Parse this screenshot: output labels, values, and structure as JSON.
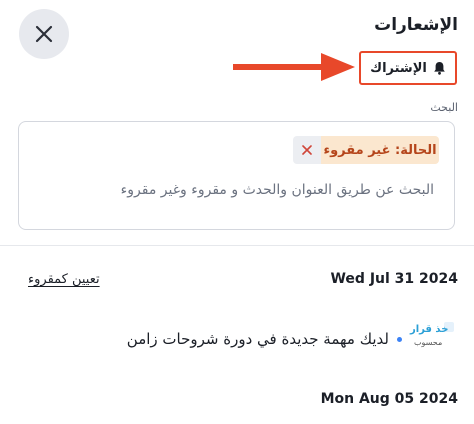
{
  "header": {
    "title": "الإشعارات",
    "subscribe_label": "الإشتراك"
  },
  "search": {
    "label": "البحث",
    "filter_chip": "الحالة: غير مقروء",
    "placeholder": "البحث عن طريق العنوان والحدث و مقروء وغير مقروء"
  },
  "groups": [
    {
      "date": "Wed Jul 31 2024",
      "action_label": "تعيين كمقروء",
      "notifications": [
        {
          "text": "لديك مهمة جديدة في دورة شروحات زامن",
          "logo_text_1": "خذ قرار",
          "logo_text_2": "محسوب"
        }
      ]
    },
    {
      "date": "Mon Aug 05 2024"
    }
  ],
  "colors": {
    "accent": "#e8482a",
    "chip_bg": "#fbe7cf",
    "chip_text": "#b5451b",
    "unread_dot": "#3b82f6"
  },
  "icons": {
    "close": "close-icon",
    "bell": "bell-icon",
    "arrow": "arrow-right-icon",
    "chip_remove": "close-icon"
  }
}
